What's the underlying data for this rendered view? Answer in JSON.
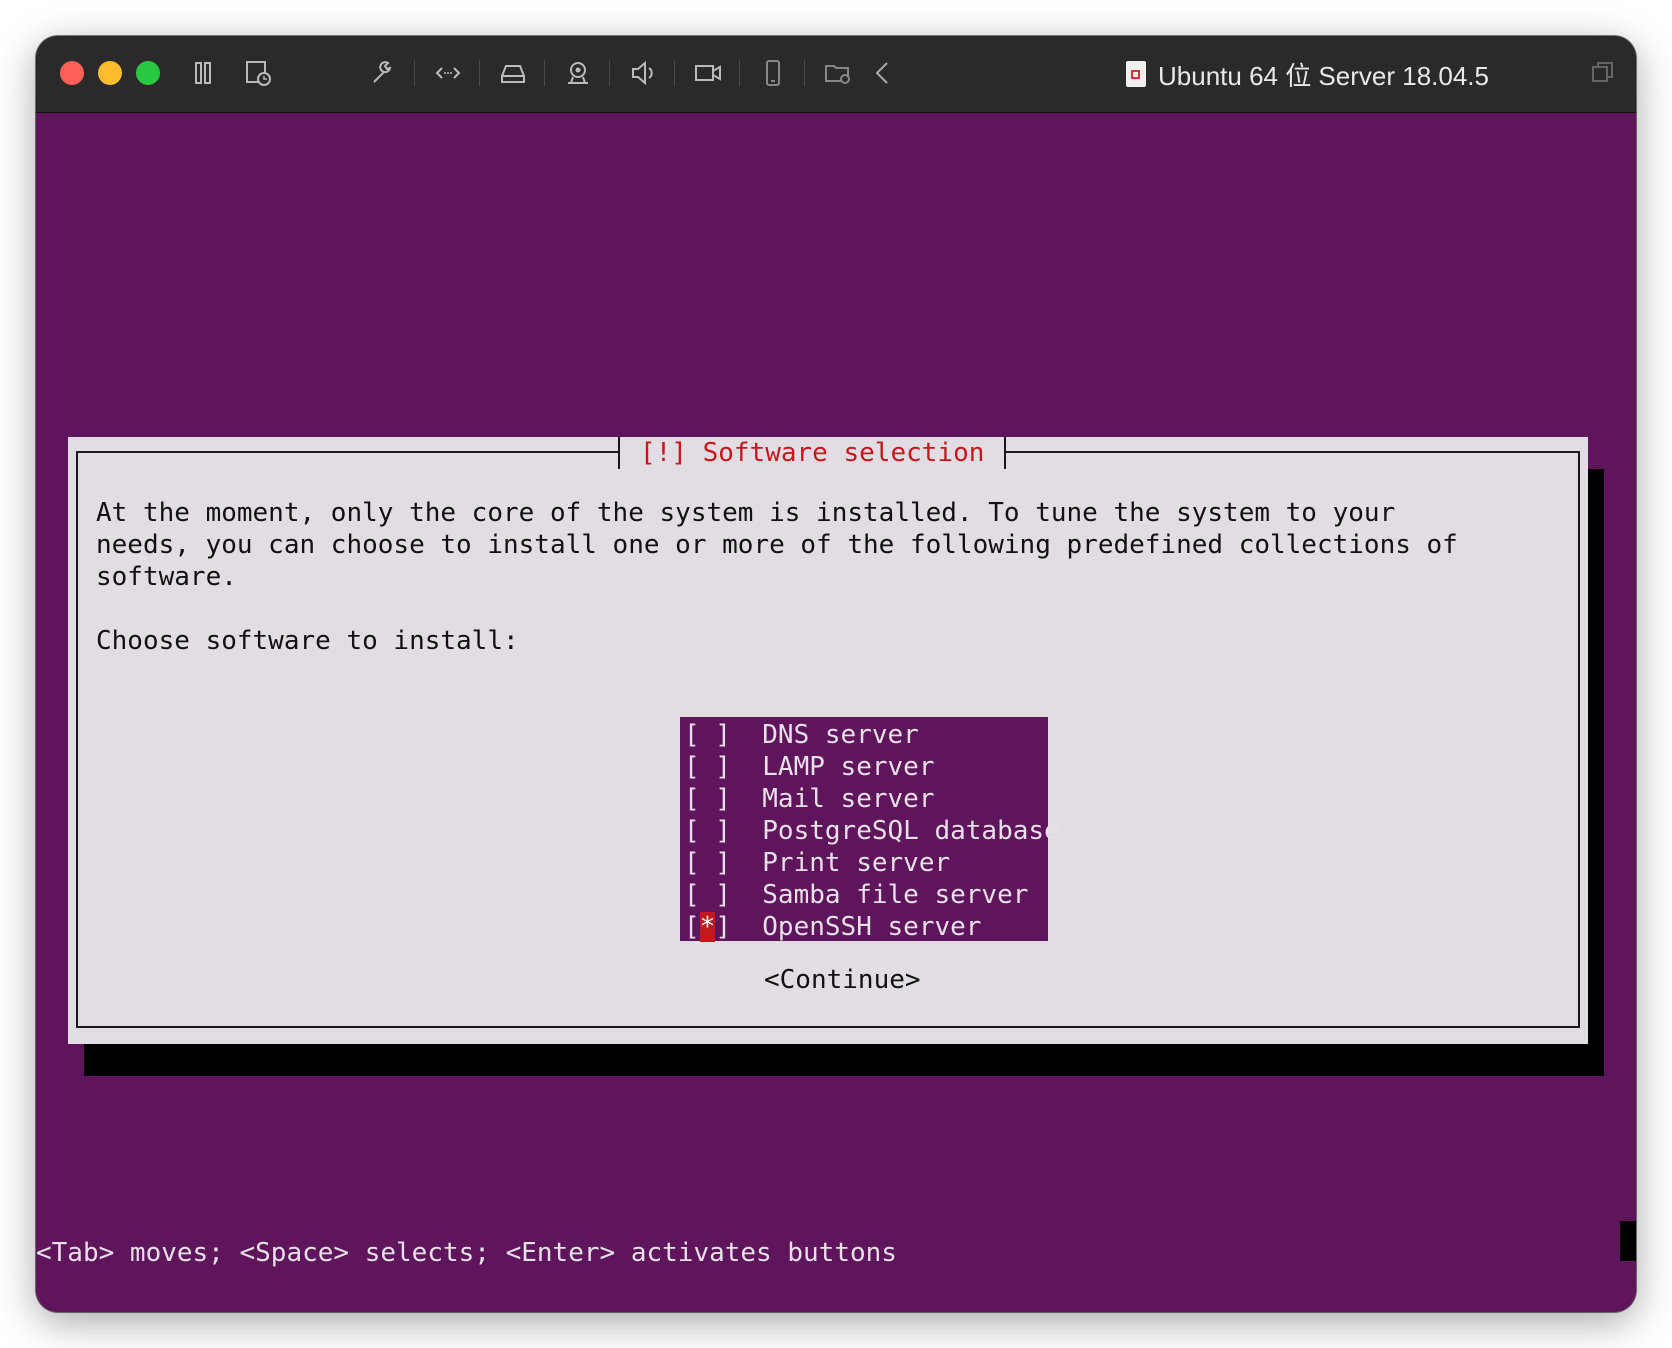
{
  "window": {
    "title": "Ubuntu 64 位 Server 18.04.5",
    "traffic_lights": {
      "close": "#ff5f57",
      "minimize": "#febc2e",
      "zoom": "#28c840"
    }
  },
  "toolbar": {
    "icons": [
      "pause-icon",
      "snapshot-icon",
      "settings-wrench-icon",
      "code-icon",
      "disk-icon",
      "camera-user-icon",
      "speaker-icon",
      "video-camera-icon",
      "phone-device-icon",
      "shared-folder-icon",
      "back-chevron-icon",
      "restore-window-icon"
    ]
  },
  "dialog": {
    "title": "[!] Software selection",
    "description_lines": [
      "At the moment, only the core of the system is installed. To tune the system to your",
      "needs, you can choose to install one or more of the following predefined collections of",
      "software."
    ],
    "prompt": "Choose software to install:",
    "options": [
      {
        "checkbox": "[ ]",
        "label": "DNS server"
      },
      {
        "checkbox": "[ ]",
        "label": "LAMP server"
      },
      {
        "checkbox": "[ ]",
        "label": "Mail server"
      },
      {
        "checkbox": "[ ]",
        "label": "PostgreSQL database"
      },
      {
        "checkbox": "[ ]",
        "label": "Print server"
      },
      {
        "checkbox": "[ ]",
        "label": "Samba file server"
      },
      {
        "checkbox_open": "[",
        "checkbox_mark": "*",
        "checkbox_close": "]",
        "label": "OpenSSH server"
      }
    ],
    "continue_button": "<Continue>"
  },
  "status_bar": {
    "text": "<Tab> moves; <Space> selects; <Enter> activates buttons"
  },
  "colors": {
    "background_purple": "#5f155c",
    "dialog_bg": "#e2dde3",
    "title_red": "#c8161d",
    "cursor_red": "#c8161d"
  }
}
